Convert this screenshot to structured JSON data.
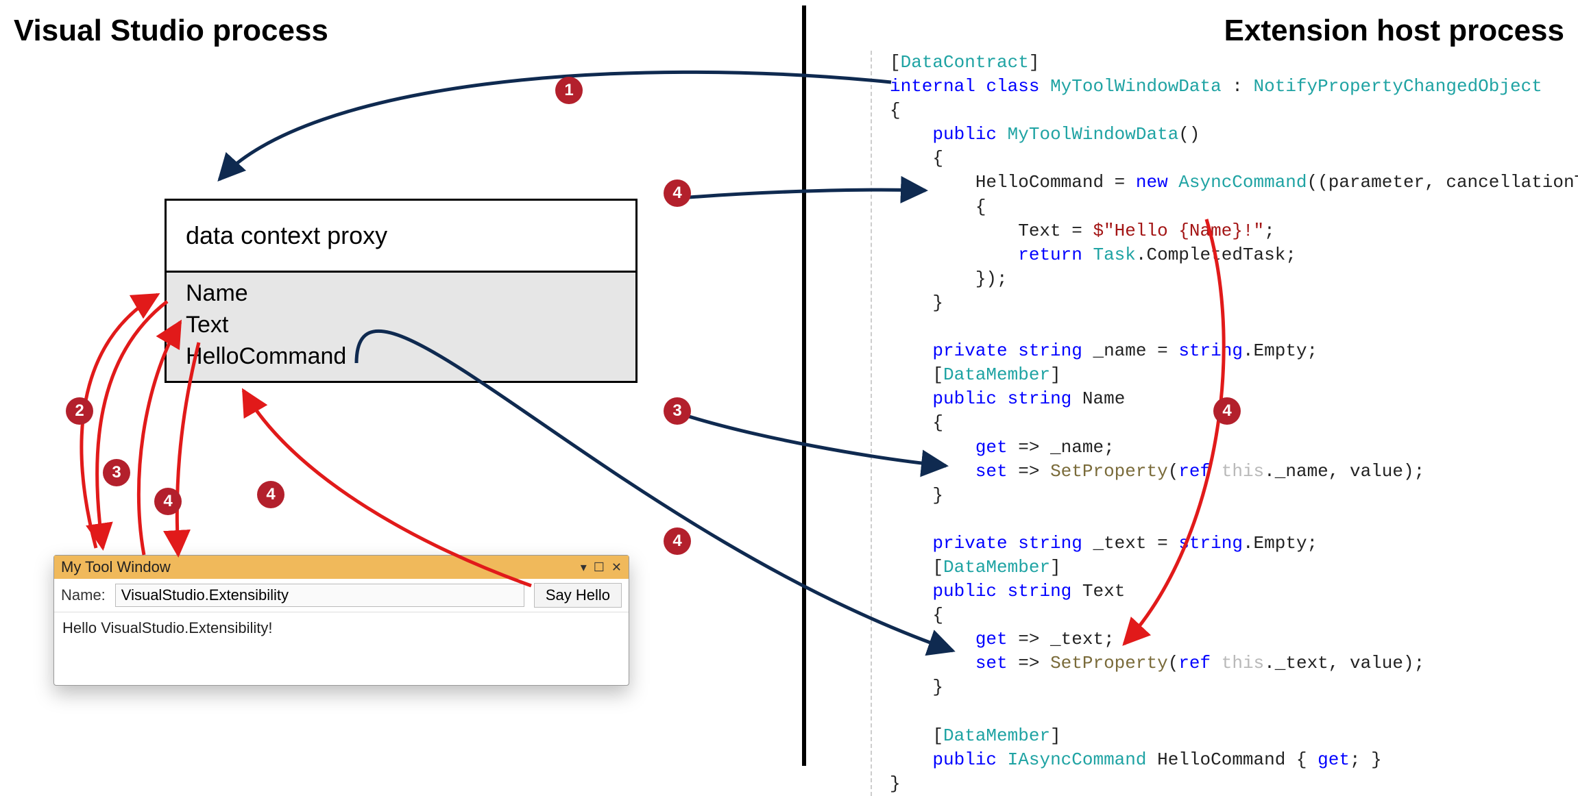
{
  "headings": {
    "left": "Visual Studio process",
    "right": "Extension host process"
  },
  "proxy": {
    "title": "data context proxy",
    "members": [
      "Name",
      "Text",
      "HelloCommand"
    ]
  },
  "tool_window": {
    "title": "My Tool Window",
    "name_label": "Name:",
    "name_value": "VisualStudio.Extensibility",
    "button_label": "Say Hello",
    "output": "Hello VisualStudio.Extensibility!"
  },
  "code": {
    "lines": [
      {
        "segs": [
          [
            "default",
            "["
          ],
          [
            "attr",
            "DataContract"
          ],
          [
            "default",
            "]"
          ]
        ]
      },
      {
        "segs": [
          [
            "kw",
            "internal"
          ],
          [
            "default",
            " "
          ],
          [
            "kw",
            "class"
          ],
          [
            "default",
            " "
          ],
          [
            "type",
            "MyToolWindowData"
          ],
          [
            "default",
            " : "
          ],
          [
            "type",
            "NotifyPropertyChangedObject"
          ]
        ]
      },
      {
        "segs": [
          [
            "default",
            "{"
          ]
        ]
      },
      {
        "segs": [
          [
            "default",
            "    "
          ],
          [
            "kw",
            "public"
          ],
          [
            "default",
            " "
          ],
          [
            "type",
            "MyToolWindowData"
          ],
          [
            "default",
            "()"
          ]
        ]
      },
      {
        "segs": [
          [
            "default",
            "    {"
          ]
        ]
      },
      {
        "segs": [
          [
            "default",
            "        HelloCommand = "
          ],
          [
            "kw",
            "new"
          ],
          [
            "default",
            " "
          ],
          [
            "type",
            "AsyncCommand"
          ],
          [
            "default",
            "((parameter, cancellationToken) =>"
          ]
        ]
      },
      {
        "segs": [
          [
            "default",
            "        {"
          ]
        ]
      },
      {
        "segs": [
          [
            "default",
            "            Text = "
          ],
          [
            "str",
            "$\"Hello {Name}!\""
          ],
          [
            "default",
            ";"
          ]
        ]
      },
      {
        "segs": [
          [
            "default",
            "            "
          ],
          [
            "kw",
            "return"
          ],
          [
            "default",
            " "
          ],
          [
            "type",
            "Task"
          ],
          [
            "default",
            ".CompletedTask;"
          ]
        ]
      },
      {
        "segs": [
          [
            "default",
            "        });"
          ]
        ]
      },
      {
        "segs": [
          [
            "default",
            "    }"
          ]
        ]
      },
      {
        "segs": [
          [
            "default",
            ""
          ]
        ]
      },
      {
        "segs": [
          [
            "default",
            "    "
          ],
          [
            "kw",
            "private"
          ],
          [
            "default",
            " "
          ],
          [
            "kw",
            "string"
          ],
          [
            "default",
            " _name = "
          ],
          [
            "kw",
            "string"
          ],
          [
            "default",
            ".Empty;"
          ]
        ]
      },
      {
        "segs": [
          [
            "default",
            "    ["
          ],
          [
            "attr",
            "DataMember"
          ],
          [
            "default",
            "]"
          ]
        ]
      },
      {
        "segs": [
          [
            "default",
            "    "
          ],
          [
            "kw",
            "public"
          ],
          [
            "default",
            " "
          ],
          [
            "kw",
            "string"
          ],
          [
            "default",
            " Name"
          ]
        ]
      },
      {
        "segs": [
          [
            "default",
            "    {"
          ]
        ]
      },
      {
        "segs": [
          [
            "default",
            "        "
          ],
          [
            "kw",
            "get"
          ],
          [
            "default",
            " => _name;"
          ]
        ]
      },
      {
        "segs": [
          [
            "default",
            "        "
          ],
          [
            "kw",
            "set"
          ],
          [
            "default",
            " => "
          ],
          [
            "method",
            "SetProperty"
          ],
          [
            "default",
            "("
          ],
          [
            "kw",
            "ref"
          ],
          [
            "default",
            " "
          ],
          [
            "fade",
            "this"
          ],
          [
            "default",
            "._name, value);"
          ]
        ]
      },
      {
        "segs": [
          [
            "default",
            "    }"
          ]
        ]
      },
      {
        "segs": [
          [
            "default",
            ""
          ]
        ]
      },
      {
        "segs": [
          [
            "default",
            "    "
          ],
          [
            "kw",
            "private"
          ],
          [
            "default",
            " "
          ],
          [
            "kw",
            "string"
          ],
          [
            "default",
            " _text = "
          ],
          [
            "kw",
            "string"
          ],
          [
            "default",
            ".Empty;"
          ]
        ]
      },
      {
        "segs": [
          [
            "default",
            "    ["
          ],
          [
            "attr",
            "DataMember"
          ],
          [
            "default",
            "]"
          ]
        ]
      },
      {
        "segs": [
          [
            "default",
            "    "
          ],
          [
            "kw",
            "public"
          ],
          [
            "default",
            " "
          ],
          [
            "kw",
            "string"
          ],
          [
            "default",
            " Text"
          ]
        ]
      },
      {
        "segs": [
          [
            "default",
            "    {"
          ]
        ]
      },
      {
        "segs": [
          [
            "default",
            "        "
          ],
          [
            "kw",
            "get"
          ],
          [
            "default",
            " => _text;"
          ]
        ]
      },
      {
        "segs": [
          [
            "default",
            "        "
          ],
          [
            "kw",
            "set"
          ],
          [
            "default",
            " => "
          ],
          [
            "method",
            "SetProperty"
          ],
          [
            "default",
            "("
          ],
          [
            "kw",
            "ref"
          ],
          [
            "default",
            " "
          ],
          [
            "fade",
            "this"
          ],
          [
            "default",
            "._text, value);"
          ]
        ]
      },
      {
        "segs": [
          [
            "default",
            "    }"
          ]
        ]
      },
      {
        "segs": [
          [
            "default",
            ""
          ]
        ]
      },
      {
        "segs": [
          [
            "default",
            "    ["
          ],
          [
            "attr",
            "DataMember"
          ],
          [
            "default",
            "]"
          ]
        ]
      },
      {
        "segs": [
          [
            "default",
            "    "
          ],
          [
            "kw",
            "public"
          ],
          [
            "default",
            " "
          ],
          [
            "type",
            "IAsyncCommand"
          ],
          [
            "default",
            " HelloCommand { "
          ],
          [
            "kw",
            "get"
          ],
          [
            "default",
            "; }"
          ]
        ]
      },
      {
        "segs": [
          [
            "default",
            "}"
          ]
        ]
      }
    ]
  },
  "badges": {
    "b1": "1",
    "b2": "2",
    "b3_left": "3",
    "b3_right": "3",
    "b4_left": "4",
    "b4_curve": "4",
    "b4_mid": "4",
    "b4_right": "4",
    "b4_bottom": "4"
  },
  "colors": {
    "badge": "#b3202c",
    "arrow_navy": "#0f2a50",
    "arrow_red": "#e11a1a"
  }
}
